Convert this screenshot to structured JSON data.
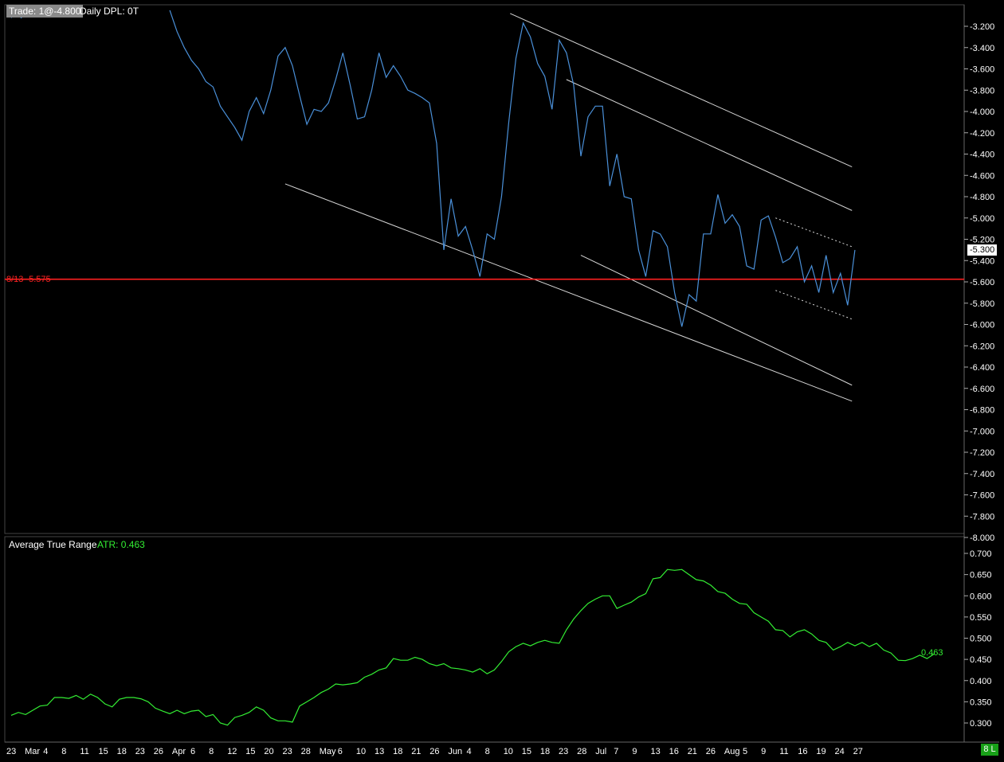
{
  "header": {
    "badge": "Trade: 1@-4.800",
    "text": "Daily DPL: 0T"
  },
  "colors": {
    "background": "#000000",
    "price_line": "#4a90d9",
    "trend_lines": "#d8d8d8",
    "reference_line": "#ff2020",
    "atr_line": "#33ee33",
    "grid_border": "#555555"
  },
  "corner_badge": "8 L",
  "chart_data": [
    {
      "type": "line",
      "title": "",
      "price_axis": {
        "ylim": [
          -8.0,
          -3.05
        ],
        "ticks": [
          "-3.200",
          "-3.400",
          "-3.600",
          "-3.800",
          "-4.000",
          "-4.200",
          "-4.400",
          "-4.600",
          "-4.800",
          "-5.000",
          "-5.200",
          "-5.400",
          "-5.600",
          "-5.800",
          "-6.000",
          "-6.200",
          "-6.400",
          "-6.600",
          "-6.800",
          "-7.000",
          "-7.200",
          "-7.400",
          "-7.600",
          "-7.800",
          "-8.000"
        ],
        "tick_values": [
          -3.2,
          -3.4,
          -3.6,
          -3.8,
          -4.0,
          -4.2,
          -4.4,
          -4.6,
          -4.8,
          -5.0,
          -5.2,
          -5.4,
          -5.6,
          -5.8,
          -6.0,
          -6.2,
          -6.4,
          -6.6,
          -6.8,
          -7.0,
          -7.2,
          -7.4,
          -7.6,
          -7.8,
          -8.0
        ]
      },
      "reference_line": {
        "label": "8/13  -5.575",
        "value": -5.575
      },
      "last_value": {
        "label": "-5.300",
        "value": -5.3
      },
      "series": [
        {
          "values": [
            [
              0,
              -3.12
            ],
            [
              0.3,
              -3.08
            ],
            [
              0.7,
              -3.12
            ],
            [
              1,
              -3.08
            ],
            [
              11,
              -3.05
            ],
            [
              11.5,
              -3.25
            ],
            [
              12,
              -3.4
            ],
            [
              12.5,
              -3.52
            ],
            [
              13,
              -3.6
            ],
            [
              13.5,
              -3.72
            ],
            [
              14,
              -3.77
            ],
            [
              14.5,
              -3.95
            ],
            [
              15,
              -4.05
            ],
            [
              15.5,
              -4.15
            ],
            [
              16,
              -4.27
            ],
            [
              16.5,
              -4.0
            ],
            [
              17,
              -3.87
            ],
            [
              17.5,
              -4.02
            ],
            [
              18,
              -3.8
            ],
            [
              18.5,
              -3.48
            ],
            [
              19,
              -3.4
            ],
            [
              19.5,
              -3.57
            ],
            [
              20,
              -3.85
            ],
            [
              20.5,
              -4.12
            ],
            [
              21,
              -3.98
            ],
            [
              21.5,
              -4.0
            ],
            [
              22,
              -3.92
            ],
            [
              22.5,
              -3.7
            ],
            [
              23,
              -3.45
            ],
            [
              23.5,
              -3.75
            ],
            [
              24,
              -4.07
            ],
            [
              24.5,
              -4.05
            ],
            [
              25,
              -3.8
            ],
            [
              25.5,
              -3.45
            ],
            [
              26,
              -3.68
            ],
            [
              26.5,
              -3.57
            ],
            [
              27,
              -3.67
            ],
            [
              27.5,
              -3.8
            ],
            [
              28,
              -3.83
            ],
            [
              28.5,
              -3.87
            ],
            [
              29,
              -3.92
            ],
            [
              29.5,
              -4.3
            ],
            [
              30,
              -5.3
            ],
            [
              30.5,
              -4.82
            ],
            [
              31,
              -5.17
            ],
            [
              31.5,
              -5.08
            ],
            [
              32,
              -5.3
            ],
            [
              32.5,
              -5.55
            ],
            [
              33,
              -5.15
            ],
            [
              33.5,
              -5.2
            ],
            [
              34,
              -4.8
            ],
            [
              34.5,
              -4.1
            ],
            [
              35,
              -3.5
            ],
            [
              35.5,
              -3.17
            ],
            [
              36,
              -3.3
            ],
            [
              36.5,
              -3.55
            ],
            [
              37,
              -3.67
            ],
            [
              37.5,
              -3.98
            ],
            [
              38,
              -3.33
            ],
            [
              38.5,
              -3.45
            ],
            [
              39,
              -3.75
            ],
            [
              39.5,
              -4.42
            ],
            [
              40,
              -4.05
            ],
            [
              40.5,
              -3.95
            ],
            [
              41,
              -3.95
            ],
            [
              41.5,
              -4.7
            ],
            [
              42,
              -4.4
            ],
            [
              42.5,
              -4.8
            ],
            [
              43,
              -4.82
            ],
            [
              43.5,
              -5.3
            ],
            [
              44,
              -5.55
            ],
            [
              44.5,
              -5.12
            ],
            [
              45,
              -5.15
            ],
            [
              45.5,
              -5.27
            ],
            [
              46,
              -5.7
            ],
            [
              46.5,
              -6.02
            ],
            [
              47,
              -5.72
            ],
            [
              47.5,
              -5.78
            ],
            [
              48,
              -5.15
            ],
            [
              48.5,
              -5.15
            ],
            [
              49,
              -4.78
            ],
            [
              49.5,
              -5.05
            ],
            [
              50,
              -4.97
            ],
            [
              50.5,
              -5.08
            ],
            [
              51,
              -5.45
            ],
            [
              51.5,
              -5.48
            ],
            [
              52,
              -5.02
            ],
            [
              52.5,
              -4.98
            ],
            [
              53,
              -5.18
            ],
            [
              53.5,
              -5.42
            ],
            [
              54,
              -5.38
            ],
            [
              54.5,
              -5.27
            ],
            [
              55,
              -5.6
            ],
            [
              55.5,
              -5.45
            ],
            [
              56,
              -5.7
            ],
            [
              56.5,
              -5.35
            ],
            [
              57,
              -5.7
            ],
            [
              57.5,
              -5.52
            ],
            [
              58,
              -5.82
            ],
            [
              58.5,
              -5.3
            ]
          ]
        }
      ],
      "trend_lines": [
        {
          "style": "solid",
          "from": [
            19,
            -4.68
          ],
          "to": [
            58.3,
            -6.72
          ]
        },
        {
          "style": "solid",
          "from": [
            34.6,
            -3.08
          ],
          "to": [
            58.3,
            -4.52
          ]
        },
        {
          "style": "solid",
          "from": [
            38.5,
            -3.7
          ],
          "to": [
            58.3,
            -4.93
          ]
        },
        {
          "style": "solid",
          "from": [
            39.5,
            -5.35
          ],
          "to": [
            58.3,
            -6.57
          ]
        },
        {
          "style": "dashed",
          "from": [
            53,
            -5.0
          ],
          "to": [
            58.3,
            -5.27
          ]
        },
        {
          "style": "dashed",
          "from": [
            53,
            -5.68
          ],
          "to": [
            58.3,
            -5.95
          ]
        }
      ]
    },
    {
      "type": "line",
      "title": "Average True Range",
      "value_label": "ATR: 0.463",
      "last_value": {
        "label": "0.463",
        "value": 0.463
      },
      "ylim": [
        0.27,
        0.715
      ],
      "ticks": [
        "0.700",
        "0.650",
        "0.600",
        "0.550",
        "0.500",
        "0.450",
        "0.400",
        "0.350",
        "0.300"
      ],
      "tick_values": [
        0.7,
        0.65,
        0.6,
        0.55,
        0.5,
        0.45,
        0.4,
        0.35,
        0.3
      ],
      "series": [
        {
          "values": [
            [
              0,
              0.318
            ],
            [
              0.5,
              0.325
            ],
            [
              1,
              0.32
            ],
            [
              1.5,
              0.33
            ],
            [
              2,
              0.34
            ],
            [
              2.5,
              0.342
            ],
            [
              3,
              0.36
            ],
            [
              3.5,
              0.36
            ],
            [
              4,
              0.358
            ],
            [
              4.5,
              0.365
            ],
            [
              5,
              0.356
            ],
            [
              5.5,
              0.368
            ],
            [
              6,
              0.36
            ],
            [
              6.5,
              0.345
            ],
            [
              7,
              0.338
            ],
            [
              7.5,
              0.356
            ],
            [
              8,
              0.36
            ],
            [
              8.5,
              0.36
            ],
            [
              9,
              0.357
            ],
            [
              9.5,
              0.35
            ],
            [
              10,
              0.335
            ],
            [
              10.5,
              0.328
            ],
            [
              11,
              0.322
            ],
            [
              11.5,
              0.33
            ],
            [
              12,
              0.322
            ],
            [
              12.5,
              0.328
            ],
            [
              13,
              0.33
            ],
            [
              13.5,
              0.315
            ],
            [
              14,
              0.32
            ],
            [
              14.5,
              0.3
            ],
            [
              15,
              0.295
            ],
            [
              15.5,
              0.313
            ],
            [
              16,
              0.318
            ],
            [
              16.5,
              0.325
            ],
            [
              17,
              0.338
            ],
            [
              17.5,
              0.33
            ],
            [
              18,
              0.312
            ],
            [
              18.5,
              0.305
            ],
            [
              19,
              0.305
            ],
            [
              19.5,
              0.302
            ],
            [
              20,
              0.34
            ],
            [
              20.5,
              0.35
            ],
            [
              21,
              0.36
            ],
            [
              21.5,
              0.372
            ],
            [
              22,
              0.38
            ],
            [
              22.5,
              0.392
            ],
            [
              23,
              0.39
            ],
            [
              23.5,
              0.392
            ],
            [
              24,
              0.395
            ],
            [
              24.5,
              0.408
            ],
            [
              25,
              0.415
            ],
            [
              25.5,
              0.425
            ],
            [
              26,
              0.43
            ],
            [
              26.5,
              0.452
            ],
            [
              27,
              0.448
            ],
            [
              27.5,
              0.448
            ],
            [
              28,
              0.455
            ],
            [
              28.5,
              0.45
            ],
            [
              29,
              0.44
            ],
            [
              29.5,
              0.435
            ],
            [
              30,
              0.44
            ],
            [
              30.5,
              0.43
            ],
            [
              31,
              0.428
            ],
            [
              31.5,
              0.425
            ],
            [
              32,
              0.42
            ],
            [
              32.5,
              0.428
            ],
            [
              33,
              0.416
            ],
            [
              33.5,
              0.425
            ],
            [
              34,
              0.445
            ],
            [
              34.5,
              0.468
            ],
            [
              35,
              0.48
            ],
            [
              35.5,
              0.488
            ],
            [
              36,
              0.482
            ],
            [
              36.5,
              0.49
            ],
            [
              37,
              0.495
            ],
            [
              37.5,
              0.49
            ],
            [
              38,
              0.488
            ],
            [
              38.5,
              0.52
            ],
            [
              39,
              0.545
            ],
            [
              39.5,
              0.565
            ],
            [
              40,
              0.582
            ],
            [
              40.5,
              0.592
            ],
            [
              41,
              0.6
            ],
            [
              41.5,
              0.6
            ],
            [
              42,
              0.57
            ],
            [
              42.5,
              0.578
            ],
            [
              43,
              0.585
            ],
            [
              43.5,
              0.597
            ],
            [
              44,
              0.605
            ],
            [
              44.5,
              0.64
            ],
            [
              45,
              0.643
            ],
            [
              45.5,
              0.662
            ],
            [
              46,
              0.66
            ],
            [
              46.5,
              0.662
            ],
            [
              47,
              0.65
            ],
            [
              47.5,
              0.638
            ],
            [
              48,
              0.635
            ],
            [
              48.5,
              0.625
            ],
            [
              49,
              0.61
            ],
            [
              49.5,
              0.606
            ],
            [
              50,
              0.592
            ],
            [
              50.5,
              0.582
            ],
            [
              51,
              0.58
            ],
            [
              51.5,
              0.56
            ],
            [
              52,
              0.55
            ],
            [
              52.5,
              0.54
            ],
            [
              53,
              0.52
            ],
            [
              53.5,
              0.518
            ],
            [
              54,
              0.503
            ],
            [
              54.5,
              0.515
            ],
            [
              55,
              0.52
            ],
            [
              55.5,
              0.51
            ],
            [
              56,
              0.495
            ],
            [
              56.5,
              0.49
            ],
            [
              57,
              0.472
            ],
            [
              57.5,
              0.48
            ],
            [
              58,
              0.49
            ],
            [
              58.5,
              0.482
            ],
            [
              59,
              0.49
            ],
            [
              59.5,
              0.48
            ],
            [
              60,
              0.488
            ],
            [
              60.5,
              0.472
            ],
            [
              61,
              0.465
            ],
            [
              61.5,
              0.448
            ],
            [
              62,
              0.447
            ],
            [
              62.5,
              0.452
            ],
            [
              63,
              0.46
            ],
            [
              63.5,
              0.452
            ],
            [
              64,
              0.463
            ]
          ]
        }
      ]
    }
  ],
  "x_axis": {
    "labels": [
      "23",
      "Mar",
      "4",
      "8",
      "11",
      "15",
      "18",
      "23",
      "26",
      "Apr",
      "6",
      "8",
      "12",
      "15",
      "20",
      "23",
      "28",
      "May",
      "6",
      "10",
      "13",
      "18",
      "21",
      "26",
      "Jun",
      "4",
      "8",
      "10",
      "15",
      "18",
      "23",
      "28",
      "Jul",
      "7",
      "9",
      "13",
      "16",
      "21",
      "26",
      "Aug",
      "5",
      "9",
      "11",
      "16",
      "19",
      "24",
      "27"
    ]
  }
}
